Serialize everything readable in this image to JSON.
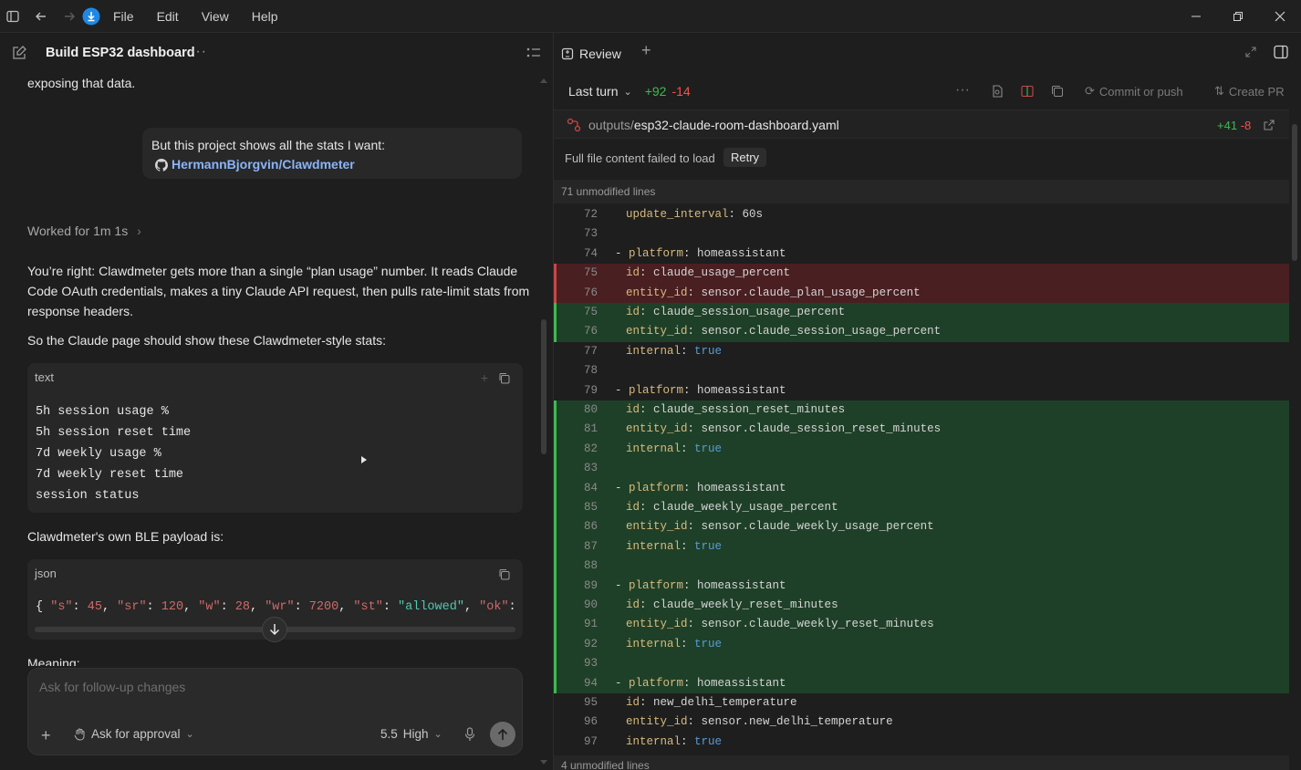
{
  "menu": [
    "File",
    "Edit",
    "View",
    "Help"
  ],
  "thread": {
    "title": "Build ESP32 dashboard",
    "top_text": "exposing that data.",
    "user_message": "But this project shows all the stats I want:",
    "user_link": "HermannBjorgvin/Clawdmeter",
    "worked_for": "Worked for 1m 1s",
    "para1_l1": "You’re right: Clawdmeter gets more than a single “plan usage” number. It reads Claude",
    "para1_l2": "Code OAuth credentials, makes a tiny Claude API request, then pulls rate-limit stats from",
    "para1_l3": "response headers.",
    "para2": "So the Claude page should show these Clawdmeter-style stats:",
    "code1_lang": "text",
    "code1_lines": [
      "5h session usage %",
      "5h session reset time",
      "7d weekly usage %",
      "7d weekly reset time",
      "session status"
    ],
    "para3": "Clawdmeter's own BLE payload is:",
    "code2_lang": "json",
    "json_parts": {
      "brace": "{",
      "k1": "\"s\"",
      "v1": "45",
      "k2": "\"sr\"",
      "v2": "120",
      "k3": "\"w\"",
      "v3": "28",
      "k4": "\"wr\"",
      "v4": "7200",
      "k5": "\"st\"",
      "v5": "\"allowed\"",
      "k6": "\"ok\"",
      "v6": "true"
    },
    "meaning": "Meaning:"
  },
  "composer": {
    "placeholder": "Ask for follow-up changes",
    "approval": "Ask for approval",
    "model": "5.5",
    "effort": "High"
  },
  "review": {
    "tab": "Review",
    "turn": "Last turn",
    "adds": "+92",
    "dels": "-14",
    "commit": "Commit or push",
    "create_pr": "Create PR",
    "file_dir": "outputs/",
    "file_name": "esp32-claude-room-dashboard.yaml",
    "file_adds": "+41",
    "file_dels": "-8",
    "error": "Full file content failed to load",
    "retry": "Retry",
    "unmod_top": "71 unmodified lines",
    "unmod_bottom": "4 unmodified lines"
  },
  "diff": [
    {
      "n": "72",
      "t": "ctx",
      "pre": "",
      "k": "update_interval",
      "v": "60s",
      "vt": "str"
    },
    {
      "n": "73",
      "t": "ctx",
      "pre": "",
      "k": "",
      "v": "",
      "vt": "str"
    },
    {
      "n": "74",
      "t": "ctx",
      "pre": "- ",
      "k": "platform",
      "v": "homeassistant",
      "vt": "str"
    },
    {
      "n": "75",
      "t": "del",
      "pre": "",
      "k": "id",
      "v": "claude_usage_percent",
      "vt": "str"
    },
    {
      "n": "76",
      "t": "del",
      "pre": "",
      "k": "entity_id",
      "v": "sensor.claude_plan_usage_percent",
      "vt": "str"
    },
    {
      "n": "75",
      "t": "add",
      "pre": "",
      "k": "id",
      "v": "claude_session_usage_percent",
      "vt": "str"
    },
    {
      "n": "76",
      "t": "add",
      "pre": "",
      "k": "entity_id",
      "v": "sensor.claude_session_usage_percent",
      "vt": "str"
    },
    {
      "n": "77",
      "t": "ctx",
      "pre": "",
      "k": "internal",
      "v": "true",
      "vt": "bool"
    },
    {
      "n": "78",
      "t": "ctx",
      "pre": "",
      "k": "",
      "v": "",
      "vt": "str"
    },
    {
      "n": "79",
      "t": "ctx",
      "pre": "- ",
      "k": "platform",
      "v": "homeassistant",
      "vt": "str"
    },
    {
      "n": "80",
      "t": "add",
      "pre": "",
      "k": "id",
      "v": "claude_session_reset_minutes",
      "vt": "str"
    },
    {
      "n": "81",
      "t": "add",
      "pre": "",
      "k": "entity_id",
      "v": "sensor.claude_session_reset_minutes",
      "vt": "str"
    },
    {
      "n": "82",
      "t": "add",
      "pre": "",
      "k": "internal",
      "v": "true",
      "vt": "bool"
    },
    {
      "n": "83",
      "t": "add",
      "pre": "",
      "k": "",
      "v": "",
      "vt": "str"
    },
    {
      "n": "84",
      "t": "add",
      "pre": "- ",
      "k": "platform",
      "v": "homeassistant",
      "vt": "str"
    },
    {
      "n": "85",
      "t": "add",
      "pre": "",
      "k": "id",
      "v": "claude_weekly_usage_percent",
      "vt": "str"
    },
    {
      "n": "86",
      "t": "add",
      "pre": "",
      "k": "entity_id",
      "v": "sensor.claude_weekly_usage_percent",
      "vt": "str"
    },
    {
      "n": "87",
      "t": "add",
      "pre": "",
      "k": "internal",
      "v": "true",
      "vt": "bool"
    },
    {
      "n": "88",
      "t": "add",
      "pre": "",
      "k": "",
      "v": "",
      "vt": "str"
    },
    {
      "n": "89",
      "t": "add",
      "pre": "- ",
      "k": "platform",
      "v": "homeassistant",
      "vt": "str"
    },
    {
      "n": "90",
      "t": "add",
      "pre": "",
      "k": "id",
      "v": "claude_weekly_reset_minutes",
      "vt": "str"
    },
    {
      "n": "91",
      "t": "add",
      "pre": "",
      "k": "entity_id",
      "v": "sensor.claude_weekly_reset_minutes",
      "vt": "str"
    },
    {
      "n": "92",
      "t": "add",
      "pre": "",
      "k": "internal",
      "v": "true",
      "vt": "bool"
    },
    {
      "n": "93",
      "t": "add",
      "pre": "",
      "k": "",
      "v": "",
      "vt": "str"
    },
    {
      "n": "94",
      "t": "add",
      "pre": "- ",
      "k": "platform",
      "v": "homeassistant",
      "vt": "str"
    },
    {
      "n": "95",
      "t": "ctx",
      "pre": "",
      "k": "id",
      "v": "new_delhi_temperature",
      "vt": "str"
    },
    {
      "n": "96",
      "t": "ctx",
      "pre": "",
      "k": "entity_id",
      "v": "sensor.new_delhi_temperature",
      "vt": "str"
    },
    {
      "n": "97",
      "t": "ctx",
      "pre": "",
      "k": "internal",
      "v": "true",
      "vt": "bool"
    }
  ],
  "colors": {
    "accent": "#1e88e5",
    "add_bg": "#1f4028",
    "del_bg": "#4a1f22",
    "json_key": "#d16969",
    "json_num": "#d16969",
    "json_str": "#4ec9b0",
    "json_bool": "#569cd6"
  }
}
